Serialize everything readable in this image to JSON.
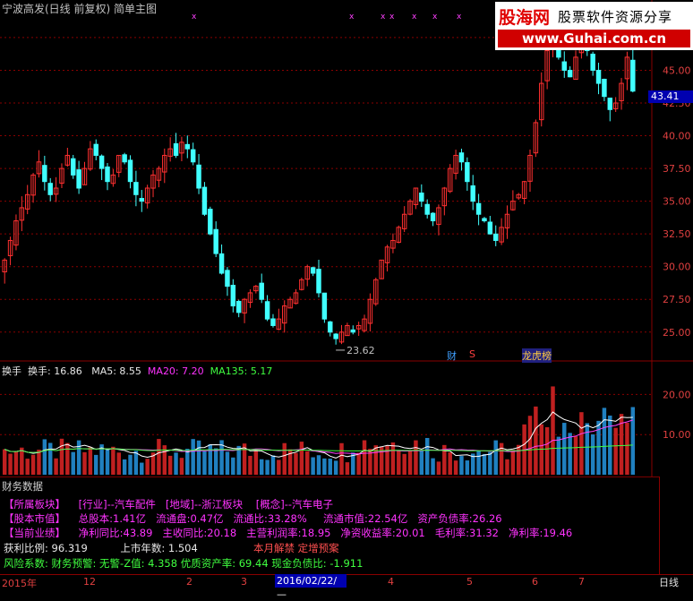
{
  "header": {
    "title": "宁波高发(日线 前复权) 简单主图",
    "x_marks": [
      "x",
      "x",
      "x",
      "x",
      "x",
      "x",
      "x"
    ]
  },
  "watermark": {
    "brand": "股海网",
    "slogan": "股票软件资源分享",
    "url": "www.Guhai.com.cn"
  },
  "price_axis": {
    "labels": [
      "47.50",
      "45.00",
      "42.50",
      "40.00",
      "37.50",
      "35.00",
      "32.50",
      "30.00",
      "27.50",
      "25.00"
    ],
    "current_price_tag": "43.41",
    "low_annotation": "23.62"
  },
  "event_badges": {
    "badge_cai": "财",
    "badge_s": "S",
    "badge_huibang": "龙虎榜"
  },
  "volume_panel": {
    "name": "换手",
    "value_label": "换手: 16.86",
    "ma5": "MA5: 8.55",
    "ma20": "MA20: 7.20",
    "ma135": "MA135: 5.17",
    "axis_labels": [
      "20.00",
      "10.00"
    ]
  },
  "financials": {
    "title": "财务数据",
    "rows": {
      "sector_label": "【所属板块】",
      "industry": "[行业]--汽车配件",
      "region": "[地域]--浙江板块",
      "concept": "[概念]--汽车电子",
      "equity_label": "【股本市值】",
      "total_shares": "总股本:1.41亿",
      "float_shares": "流通盘:0.47亿",
      "float_ratio": "流通比:33.28%",
      "float_cap": "流通市值:22.54亿",
      "debt_ratio": "资产负债率:26.26",
      "perf_label": "【当前业绩】",
      "net_profit_yoy": "净利同比:43.89",
      "revenue_yoy": "主收同比:20.18",
      "main_profit_rate": "主营利润率:18.95",
      "roe": "净资收益率:20.01",
      "gross_margin": "毛利率:31.32",
      "net_margin": "净利率:19.46",
      "profit_ratio": "获利比例: 96.319",
      "years_listed": "上市年数: 1.504",
      "notice": "本月解禁 定增预案",
      "risk_line": "风险系数: 财务预警: 无警-Z值: 4.358 优质资产率: 69.44 现金负债比: -1.911"
    }
  },
  "time_axis": {
    "labels": [
      "2015年",
      "12",
      "2",
      "3",
      "4",
      "5",
      "6",
      "7"
    ],
    "cursor_date": "2016/02/22/—",
    "period": "日线"
  },
  "colors": {
    "up": "#ff3030",
    "down": "#40ffff",
    "ma5": "#ffffff",
    "ma20": "#ff40ff",
    "ma135": "#40ff40",
    "grid": "#8a0000"
  },
  "chart_data": {
    "type": "candlestick",
    "title": "宁波高发(日线 前复权) 简单主图",
    "ylim": [
      23,
      49
    ],
    "low_annotation": 23.62,
    "last_price": 43.41,
    "closes": [
      30.5,
      32.0,
      33.5,
      34.5,
      35.5,
      37.0,
      38.0,
      36.5,
      35.5,
      36.0,
      37.5,
      38.5,
      37.0,
      36.0,
      37.5,
      39.0,
      38.5,
      37.5,
      36.5,
      37.0,
      38.5,
      38.0,
      36.5,
      35.5,
      35.0,
      36.0,
      37.0,
      37.5,
      38.5,
      39.0,
      38.5,
      39.5,
      39.0,
      38.0,
      36.0,
      34.0,
      32.5,
      31.0,
      29.5,
      28.5,
      27.0,
      26.5,
      27.5,
      28.0,
      28.5,
      27.5,
      26.0,
      25.5,
      26.0,
      27.0,
      27.5,
      28.0,
      29.0,
      30.0,
      29.5,
      28.0,
      26.0,
      25.0,
      24.5,
      25.0,
      25.5,
      25.0,
      25.5,
      26.0,
      27.5,
      29.0,
      30.5,
      31.5,
      32.0,
      33.0,
      34.0,
      35.0,
      36.0,
      35.0,
      34.0,
      33.5,
      34.5,
      36.0,
      37.5,
      38.5,
      38.0,
      36.5,
      35.0,
      34.0,
      33.5,
      32.5,
      32.0,
      33.0,
      34.0,
      35.0,
      35.5,
      36.5,
      38.5,
      41.0,
      44.0,
      46.5,
      48.0,
      46.0,
      45.0,
      44.5,
      46.0,
      47.0,
      46.5,
      45.0,
      44.0,
      43.0,
      42.0,
      42.5,
      44.0,
      46.0,
      43.41
    ]
  }
}
